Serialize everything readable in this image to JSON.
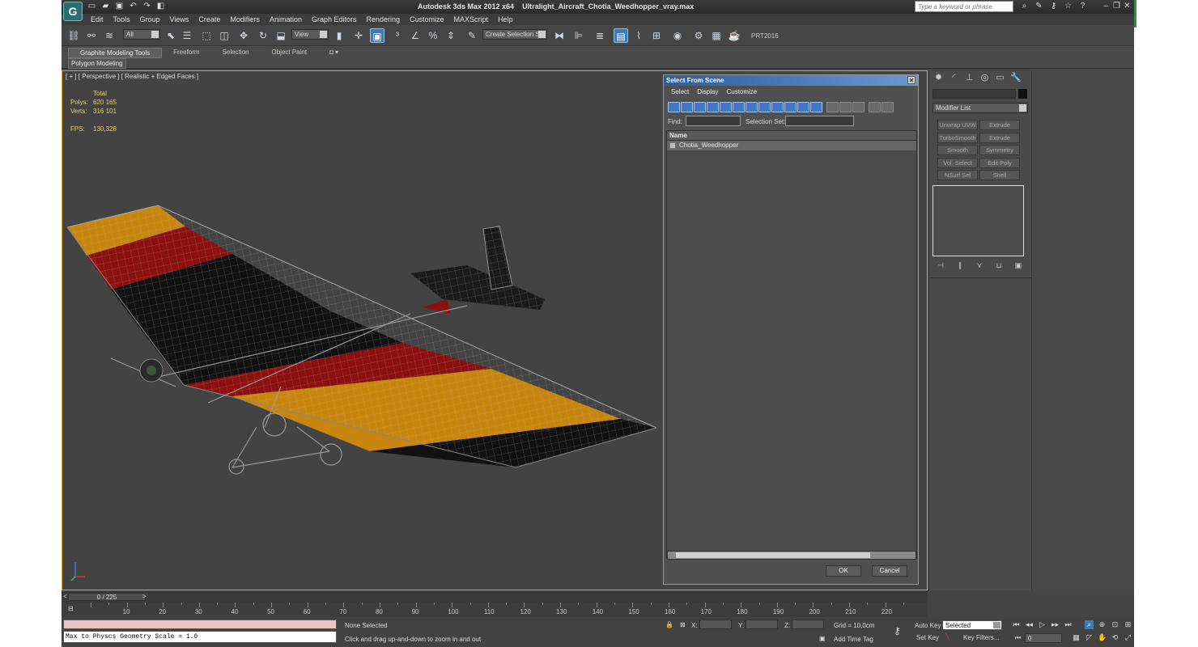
{
  "app": {
    "logo": "G",
    "title": "Autodesk 3ds Max  2012 x64",
    "file": "Ultralight_Aircraft_Chotia_Weedhopper_vray.max",
    "search_placeholder": "Type a keyword or phrase"
  },
  "menu": [
    "Edit",
    "Tools",
    "Group",
    "Views",
    "Create",
    "Modifiers",
    "Animation",
    "Graph Editors",
    "Rendering",
    "Customize",
    "MAXScript",
    "Help"
  ],
  "toolbar": {
    "selection_filter": "All",
    "ref_coord": "View",
    "named_selection": "Create Selection Se",
    "plugin_label": "PRT2016"
  },
  "ribbon": {
    "tabs": [
      "Graphite Modeling Tools",
      "Freeform",
      "Selection",
      "Object Paint"
    ],
    "sub": "Polygon Modeling"
  },
  "viewport": {
    "label": "[ + ] [ Perspective ] [ Realistic + Edged Faces ]",
    "stats_header": "Total",
    "polys_label": "Polys:",
    "polys": "620 165",
    "verts_label": "Verts:",
    "verts": "316 101",
    "fps_label": "FPS:",
    "fps": "130,328"
  },
  "dialog": {
    "title": "Select From Scene",
    "menu": [
      "Select",
      "Display",
      "Customize"
    ],
    "find_label": "Find:",
    "selset_label": "Selection Set:",
    "column": "Name",
    "rows": [
      "Chotia_Weedhopper"
    ],
    "ok": "OK",
    "cancel": "Cancel"
  },
  "command_panel": {
    "modifier_list": "Modifier List",
    "buttons": [
      "Unwrap UVW",
      "Extrude",
      "TurboSmooth",
      "Extrude",
      "Smooth",
      "Symmetry",
      "Vol. Select",
      "Edit Poly",
      "NSurf Sel",
      "Shell"
    ]
  },
  "timeline": {
    "frame": "0 / 225",
    "ticks": [
      "10",
      "20",
      "30",
      "40",
      "50",
      "60",
      "70",
      "80",
      "90",
      "100",
      "110",
      "120",
      "130",
      "140",
      "150",
      "160",
      "170",
      "180",
      "190",
      "200",
      "210",
      "220"
    ]
  },
  "status": {
    "maxscript": "Max to Physcs Geometry Scale = 1.0",
    "selected": "None Selected",
    "hint": "Click and drag up-and-down to zoom in and out",
    "x_label": "X:",
    "y_label": "Y:",
    "z_label": "Z:",
    "grid": "Grid = 10,0cm",
    "add_time_tag": "Add Time Tag",
    "auto_key": "Auto Key",
    "auto_key_mode": "Selected",
    "set_key": "Set Key",
    "key_filters": "Key Filters...",
    "frame_value": "0"
  },
  "colors": {
    "viewport_border": "#dba923",
    "wing_orange": "#c8860e",
    "wing_red": "#8c1010",
    "stats_text": "#e8d46a"
  }
}
